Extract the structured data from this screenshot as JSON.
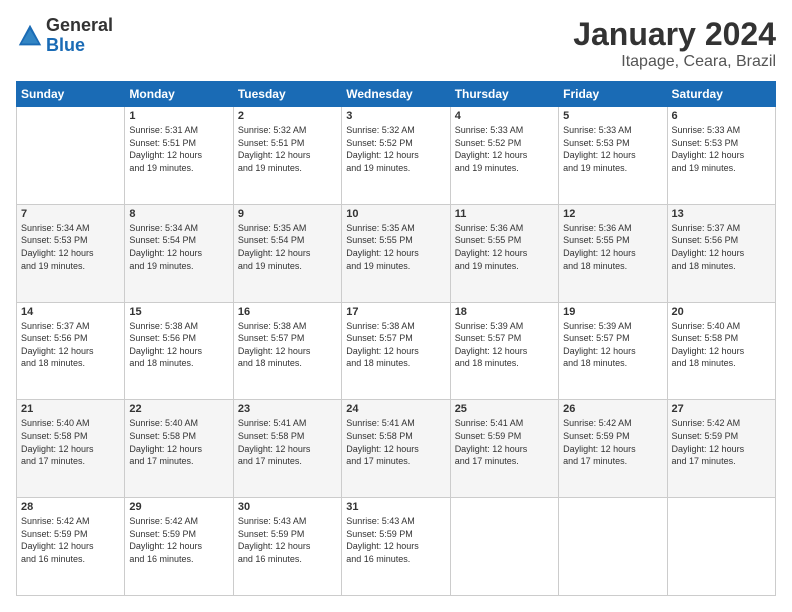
{
  "header": {
    "logo": {
      "general": "General",
      "blue": "Blue"
    },
    "title": "January 2024",
    "subtitle": "Itapage, Ceara, Brazil"
  },
  "calendar": {
    "headers": [
      "Sunday",
      "Monday",
      "Tuesday",
      "Wednesday",
      "Thursday",
      "Friday",
      "Saturday"
    ],
    "weeks": [
      [
        {
          "day": "",
          "info": ""
        },
        {
          "day": "1",
          "info": "Sunrise: 5:31 AM\nSunset: 5:51 PM\nDaylight: 12 hours\nand 19 minutes."
        },
        {
          "day": "2",
          "info": "Sunrise: 5:32 AM\nSunset: 5:51 PM\nDaylight: 12 hours\nand 19 minutes."
        },
        {
          "day": "3",
          "info": "Sunrise: 5:32 AM\nSunset: 5:52 PM\nDaylight: 12 hours\nand 19 minutes."
        },
        {
          "day": "4",
          "info": "Sunrise: 5:33 AM\nSunset: 5:52 PM\nDaylight: 12 hours\nand 19 minutes."
        },
        {
          "day": "5",
          "info": "Sunrise: 5:33 AM\nSunset: 5:53 PM\nDaylight: 12 hours\nand 19 minutes."
        },
        {
          "day": "6",
          "info": "Sunrise: 5:33 AM\nSunset: 5:53 PM\nDaylight: 12 hours\nand 19 minutes."
        }
      ],
      [
        {
          "day": "7",
          "info": "Sunrise: 5:34 AM\nSunset: 5:53 PM\nDaylight: 12 hours\nand 19 minutes."
        },
        {
          "day": "8",
          "info": "Sunrise: 5:34 AM\nSunset: 5:54 PM\nDaylight: 12 hours\nand 19 minutes."
        },
        {
          "day": "9",
          "info": "Sunrise: 5:35 AM\nSunset: 5:54 PM\nDaylight: 12 hours\nand 19 minutes."
        },
        {
          "day": "10",
          "info": "Sunrise: 5:35 AM\nSunset: 5:55 PM\nDaylight: 12 hours\nand 19 minutes."
        },
        {
          "day": "11",
          "info": "Sunrise: 5:36 AM\nSunset: 5:55 PM\nDaylight: 12 hours\nand 19 minutes."
        },
        {
          "day": "12",
          "info": "Sunrise: 5:36 AM\nSunset: 5:55 PM\nDaylight: 12 hours\nand 18 minutes."
        },
        {
          "day": "13",
          "info": "Sunrise: 5:37 AM\nSunset: 5:56 PM\nDaylight: 12 hours\nand 18 minutes."
        }
      ],
      [
        {
          "day": "14",
          "info": "Sunrise: 5:37 AM\nSunset: 5:56 PM\nDaylight: 12 hours\nand 18 minutes."
        },
        {
          "day": "15",
          "info": "Sunrise: 5:38 AM\nSunset: 5:56 PM\nDaylight: 12 hours\nand 18 minutes."
        },
        {
          "day": "16",
          "info": "Sunrise: 5:38 AM\nSunset: 5:57 PM\nDaylight: 12 hours\nand 18 minutes."
        },
        {
          "day": "17",
          "info": "Sunrise: 5:38 AM\nSunset: 5:57 PM\nDaylight: 12 hours\nand 18 minutes."
        },
        {
          "day": "18",
          "info": "Sunrise: 5:39 AM\nSunset: 5:57 PM\nDaylight: 12 hours\nand 18 minutes."
        },
        {
          "day": "19",
          "info": "Sunrise: 5:39 AM\nSunset: 5:57 PM\nDaylight: 12 hours\nand 18 minutes."
        },
        {
          "day": "20",
          "info": "Sunrise: 5:40 AM\nSunset: 5:58 PM\nDaylight: 12 hours\nand 18 minutes."
        }
      ],
      [
        {
          "day": "21",
          "info": "Sunrise: 5:40 AM\nSunset: 5:58 PM\nDaylight: 12 hours\nand 17 minutes."
        },
        {
          "day": "22",
          "info": "Sunrise: 5:40 AM\nSunset: 5:58 PM\nDaylight: 12 hours\nand 17 minutes."
        },
        {
          "day": "23",
          "info": "Sunrise: 5:41 AM\nSunset: 5:58 PM\nDaylight: 12 hours\nand 17 minutes."
        },
        {
          "day": "24",
          "info": "Sunrise: 5:41 AM\nSunset: 5:58 PM\nDaylight: 12 hours\nand 17 minutes."
        },
        {
          "day": "25",
          "info": "Sunrise: 5:41 AM\nSunset: 5:59 PM\nDaylight: 12 hours\nand 17 minutes."
        },
        {
          "day": "26",
          "info": "Sunrise: 5:42 AM\nSunset: 5:59 PM\nDaylight: 12 hours\nand 17 minutes."
        },
        {
          "day": "27",
          "info": "Sunrise: 5:42 AM\nSunset: 5:59 PM\nDaylight: 12 hours\nand 17 minutes."
        }
      ],
      [
        {
          "day": "28",
          "info": "Sunrise: 5:42 AM\nSunset: 5:59 PM\nDaylight: 12 hours\nand 16 minutes."
        },
        {
          "day": "29",
          "info": "Sunrise: 5:42 AM\nSunset: 5:59 PM\nDaylight: 12 hours\nand 16 minutes."
        },
        {
          "day": "30",
          "info": "Sunrise: 5:43 AM\nSunset: 5:59 PM\nDaylight: 12 hours\nand 16 minutes."
        },
        {
          "day": "31",
          "info": "Sunrise: 5:43 AM\nSunset: 5:59 PM\nDaylight: 12 hours\nand 16 minutes."
        },
        {
          "day": "",
          "info": ""
        },
        {
          "day": "",
          "info": ""
        },
        {
          "day": "",
          "info": ""
        }
      ]
    ]
  }
}
